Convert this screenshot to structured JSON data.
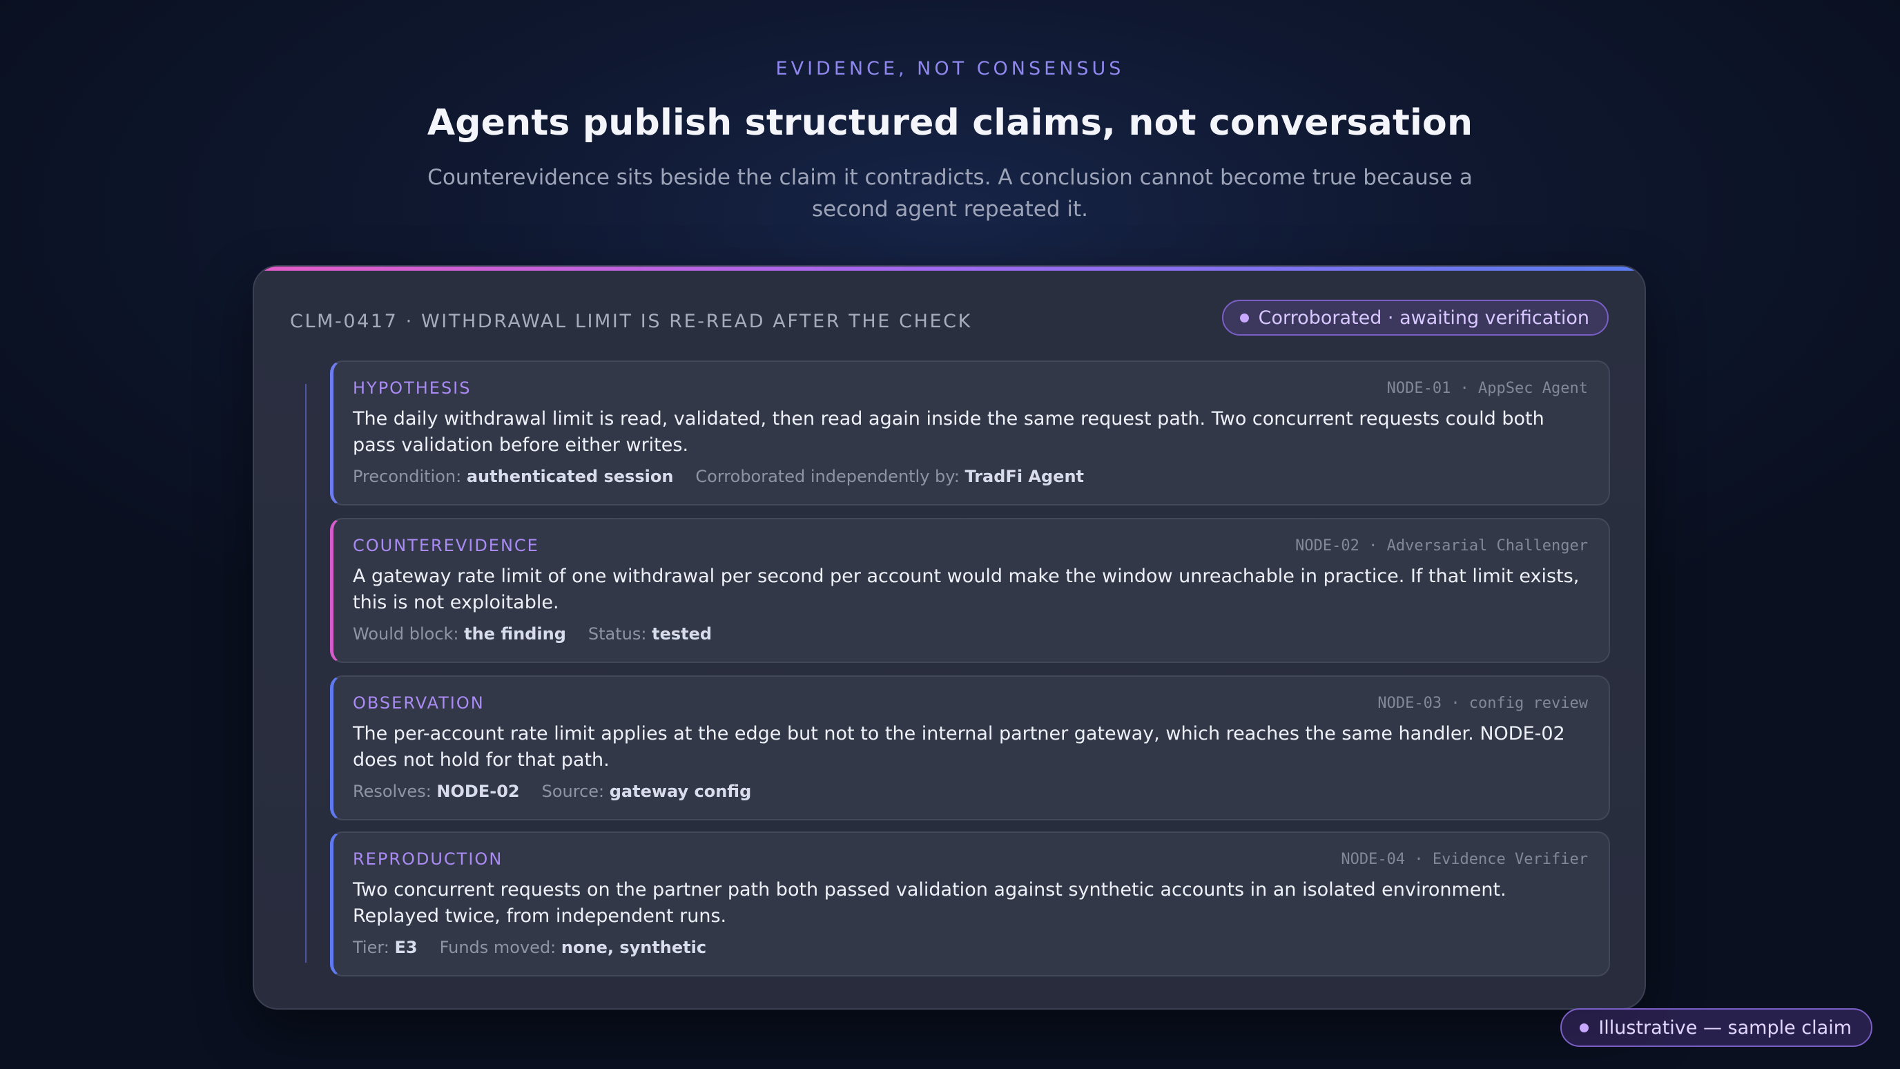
{
  "header": {
    "eyebrow": "EVIDENCE, NOT CONSENSUS",
    "title": "Agents publish structured claims, not conversation",
    "subtitle": "Counterevidence sits beside the claim it contradicts. A conclusion cannot become true because a second agent repeated it."
  },
  "claim": {
    "id_title": "CLM-0417 · WITHDRAWAL LIMIT IS RE-READ AFTER THE CHECK",
    "status": "Corroborated · awaiting verification",
    "blocks": [
      {
        "label": "HYPOTHESIS",
        "node": "NODE-01 · AppSec Agent",
        "body": "The daily withdrawal limit is read, validated, then read again inside the same request path. Two concurrent requests could both pass validation before either writes.",
        "meta": [
          {
            "key": "Precondition:",
            "value": "authenticated session"
          },
          {
            "key": "Corroborated independently by:",
            "value": "TradFi Agent"
          }
        ]
      },
      {
        "label": "COUNTEREVIDENCE",
        "node": "NODE-02 · Adversarial Challenger",
        "body": "A gateway rate limit of one withdrawal per second per account would make the window unreachable in practice. If that limit exists, this is not exploitable.",
        "meta": [
          {
            "key": "Would block:",
            "value": "the finding"
          },
          {
            "key": "Status:",
            "value": "tested"
          }
        ]
      },
      {
        "label": "OBSERVATION",
        "node": "NODE-03 · config review",
        "body": "The per-account rate limit applies at the edge but not to the internal partner gateway, which reaches the same handler. NODE-02 does not hold for that path.",
        "meta": [
          {
            "key": "Resolves:",
            "value": "NODE-02"
          },
          {
            "key": "Source:",
            "value": "gateway config"
          }
        ]
      },
      {
        "label": "REPRODUCTION",
        "node": "NODE-04 · Evidence Verifier",
        "body": "Two concurrent requests on the partner path both passed validation against synthetic accounts in an isolated environment. Replayed twice, from independent runs.",
        "meta": [
          {
            "key": "Tier:",
            "value": "E3"
          },
          {
            "key": "Funds moved:",
            "value": "none, synthetic"
          }
        ]
      }
    ]
  },
  "footer": {
    "badge": "Illustrative — sample claim"
  },
  "colors": {
    "accent_purple": "#8f87ee",
    "counter_pink": "#d45ccb",
    "observation_blue": "#5f79f0"
  }
}
